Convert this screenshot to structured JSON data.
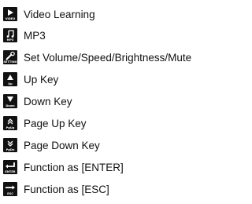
{
  "items": [
    {
      "label": "Video Learning",
      "icon": "play-icon",
      "caption": "VIDEO"
    },
    {
      "label": "MP3",
      "icon": "music-note-icon",
      "caption": "MP3"
    },
    {
      "label": "Set Volume/Speed/Brightness/Mute",
      "icon": "setting-icon",
      "caption": "SETTING"
    },
    {
      "label": "Up Key",
      "icon": "arrow-up-icon",
      "caption": "Up"
    },
    {
      "label": "Down Key",
      "icon": "arrow-down-icon",
      "caption": "Down"
    },
    {
      "label": "Page Up Key",
      "icon": "page-up-icon",
      "caption": "PgUp"
    },
    {
      "label": "Page Down Key",
      "icon": "page-down-icon",
      "caption": "PgDn"
    },
    {
      "label": "Function as [ENTER]",
      "icon": "enter-icon",
      "caption": "ENTER"
    },
    {
      "label": "Function as [ESC]",
      "icon": "esc-icon",
      "caption": "ESC"
    }
  ]
}
